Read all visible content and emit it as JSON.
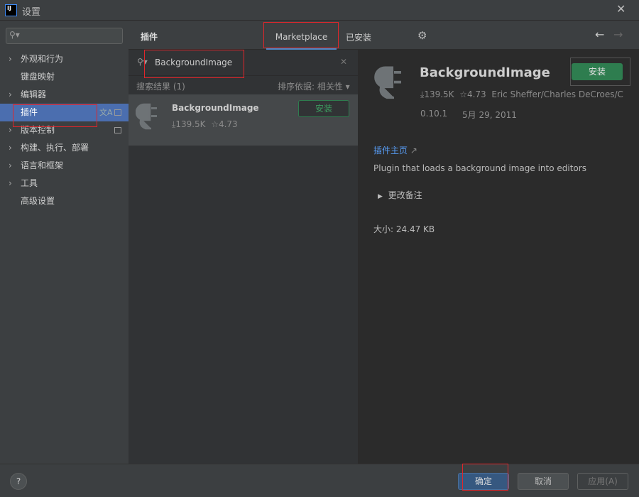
{
  "window": {
    "title": "设置",
    "logo": "IJ"
  },
  "sidebar": {
    "search_placeholder": "",
    "items": [
      {
        "label": "外观和行为",
        "expandable": true
      },
      {
        "label": "键盘映射",
        "expandable": false
      },
      {
        "label": "编辑器",
        "expandable": true
      },
      {
        "label": "插件",
        "expandable": false,
        "selected": true
      },
      {
        "label": "版本控制",
        "expandable": true
      },
      {
        "label": "构建、执行、部署",
        "expandable": true
      },
      {
        "label": "语言和框架",
        "expandable": true
      },
      {
        "label": "工具",
        "expandable": true
      },
      {
        "label": "高级设置",
        "expandable": false
      }
    ]
  },
  "header": {
    "title": "插件",
    "tabs": [
      {
        "label": "Marketplace",
        "active": true
      },
      {
        "label": "已安装",
        "active": false
      }
    ]
  },
  "search": {
    "value": "BackgroundImage"
  },
  "results": {
    "count_label": "搜索结果 (1)",
    "sort_label": "排序依据: 相关性",
    "items": [
      {
        "name": "BackgroundImage",
        "downloads": "139.5K",
        "rating": "4.73",
        "install_label": "安装"
      }
    ]
  },
  "detail": {
    "name": "BackgroundImage",
    "install_label": "安装",
    "downloads": "139.5K",
    "rating": "4.73",
    "authors": "Eric Sheffer/Charles DeCroes/C",
    "version": "0.10.1",
    "date": "5月 29, 2011",
    "homepage_label": "插件主页",
    "description": "Plugin that loads a background image into editors",
    "change_notes_label": "更改备注",
    "size_label": "大小: 24.47 KB"
  },
  "footer": {
    "help": "?",
    "ok": "确定",
    "cancel": "取消",
    "apply": "应用(A)"
  },
  "colors": {
    "accent": "#4b6eaf",
    "install_green": "#2e7d4f",
    "link": "#589df6",
    "highlight": "#e0262b"
  }
}
